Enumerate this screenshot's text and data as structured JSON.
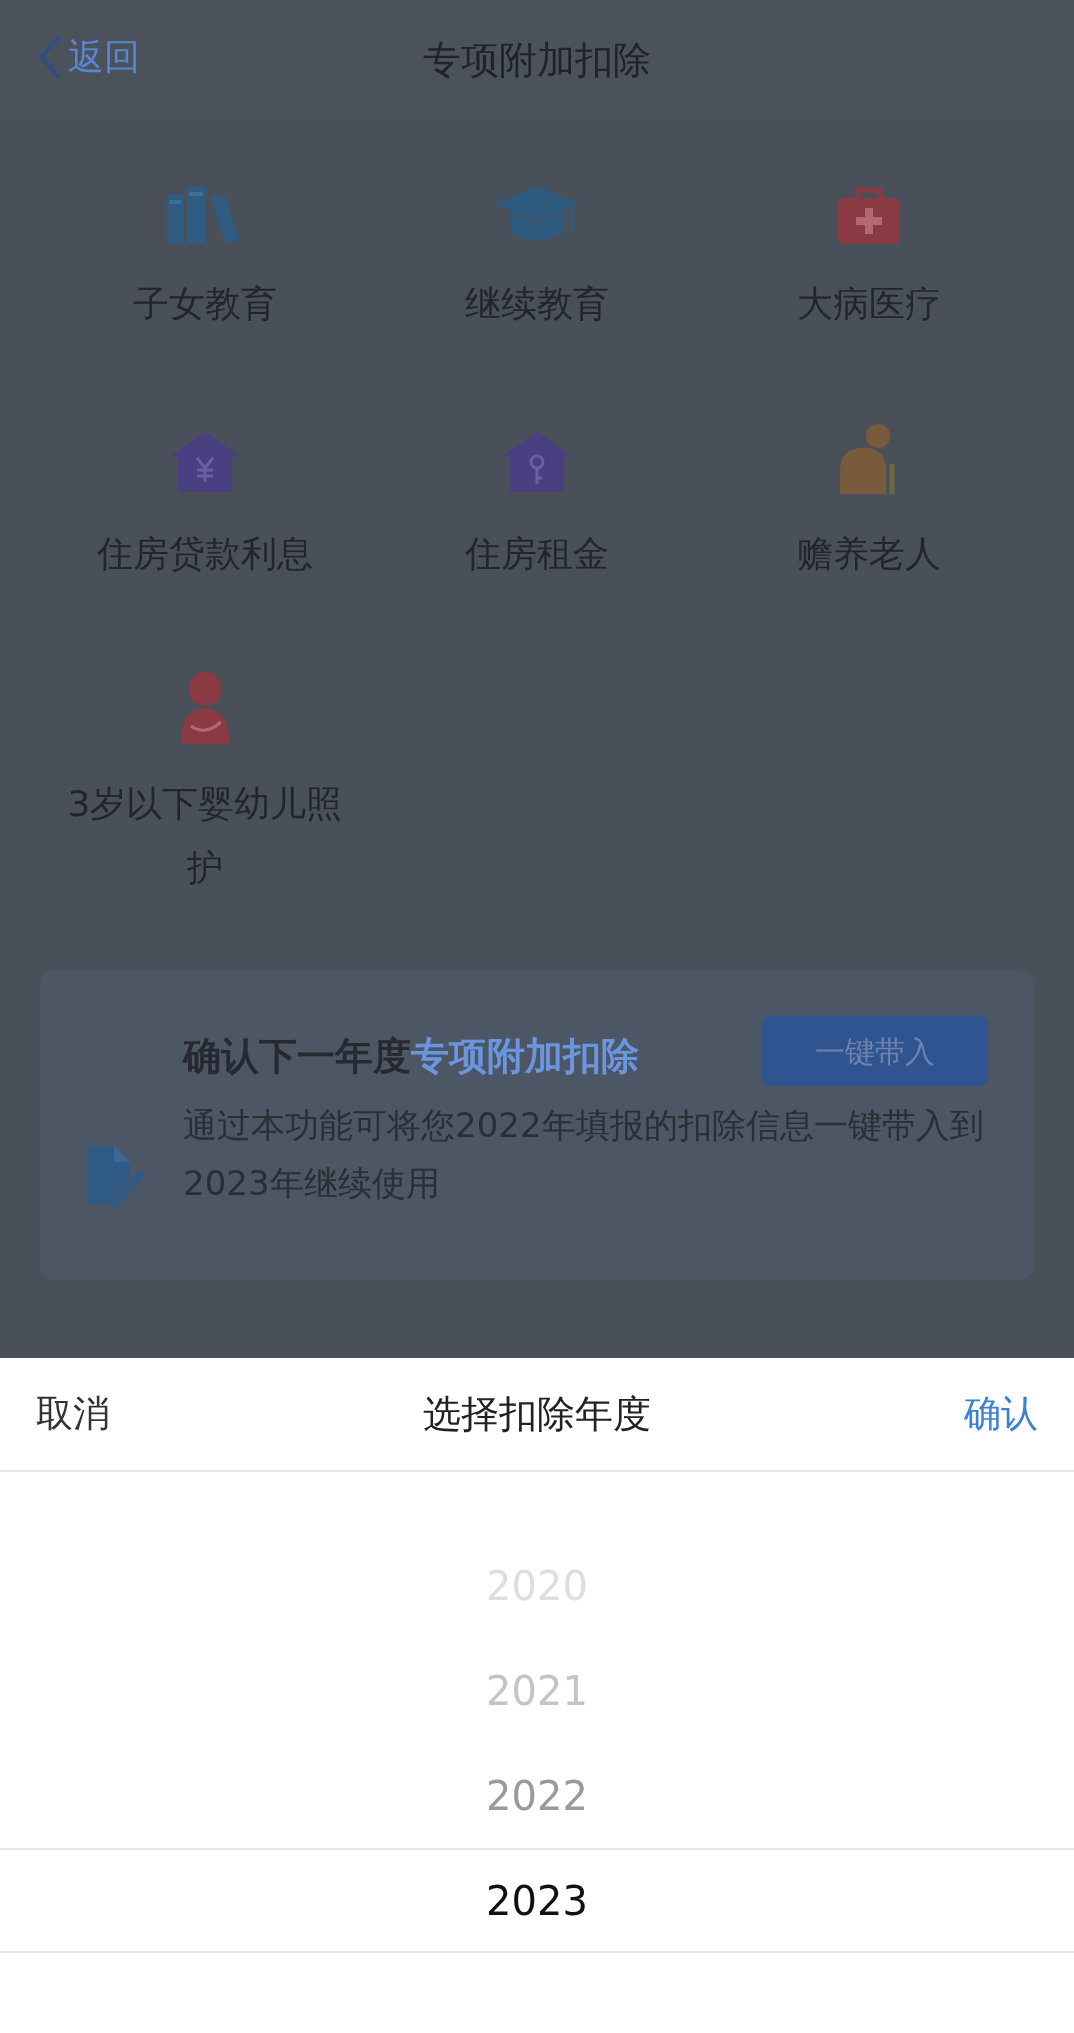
{
  "header": {
    "back_label": "返回",
    "title": "专项附加扣除"
  },
  "categories": [
    {
      "label": "子女教育",
      "kind": "books"
    },
    {
      "label": "继续教育",
      "kind": "cap"
    },
    {
      "label": "大病医疗",
      "kind": "medkit"
    },
    {
      "label": "住房贷款利息",
      "kind": "house-yen"
    },
    {
      "label": "住房租金",
      "kind": "house-key"
    },
    {
      "label": "赡养老人",
      "kind": "elder"
    },
    {
      "label": "3岁以下婴幼儿照护",
      "kind": "mother"
    }
  ],
  "carry_card": {
    "heading": "确认下一年度",
    "heading_highlight": "专项附加扣除",
    "button": "一键带入",
    "description": "通过本功能可将您2022年填报的扣除信息一键带入到2023年继续使用"
  },
  "picker": {
    "cancel": "取消",
    "title": "选择扣除年度",
    "confirm": "确认",
    "years": [
      {
        "label": "2020",
        "selected": false
      },
      {
        "label": "2021",
        "selected": false
      },
      {
        "label": "2022",
        "selected": false
      },
      {
        "label": "2023",
        "selected": true
      }
    ]
  }
}
